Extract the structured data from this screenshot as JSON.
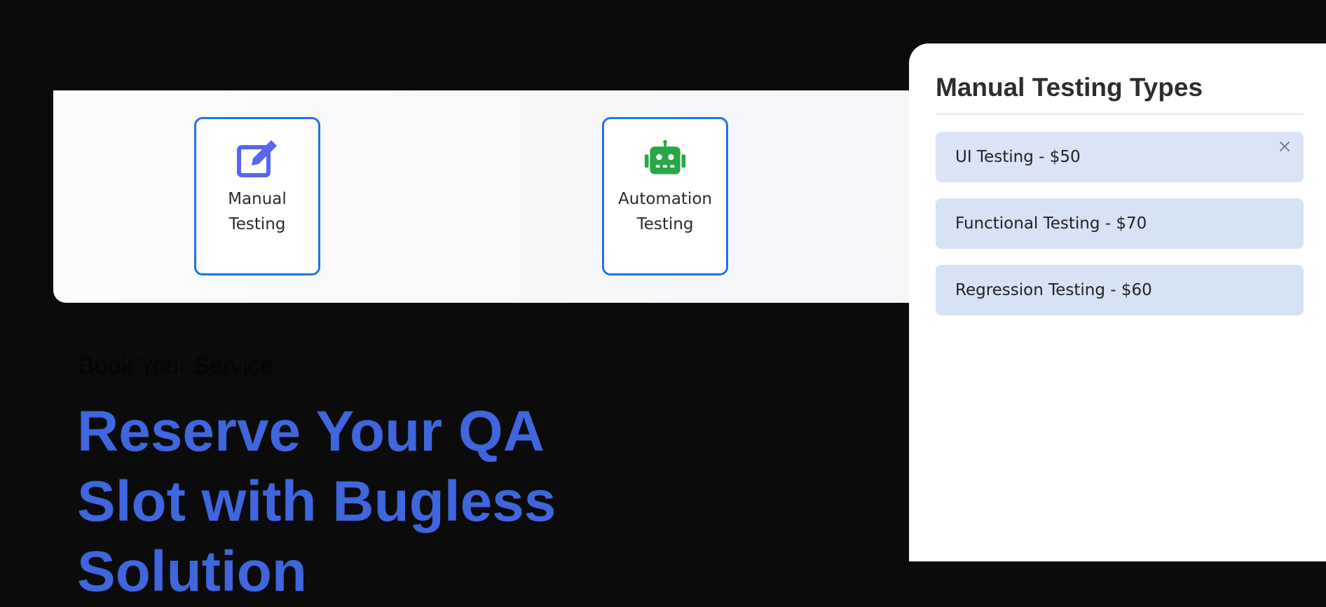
{
  "services": [
    {
      "label": "Manual Testing",
      "icon": "edit-icon",
      "icon_color": "#5865f2"
    },
    {
      "label": "Automation Testing",
      "icon": "robot-icon",
      "icon_color": "#28a745"
    }
  ],
  "hero": {
    "eyebrow": "Book Your Service",
    "title": "Reserve Your QA Slot with Bugless Solution"
  },
  "panel": {
    "title": "Manual Testing Types",
    "options": [
      {
        "label": "UI Testing - $50"
      },
      {
        "label": "Functional Testing - $70"
      },
      {
        "label": "Regression Testing - $60"
      }
    ],
    "close_icon": "close-icon"
  },
  "colors": {
    "accent": "#1f73e6",
    "hero_title": "#3f66dd",
    "background": "#0b0b0c",
    "option_bg": "#d6e2f6"
  }
}
